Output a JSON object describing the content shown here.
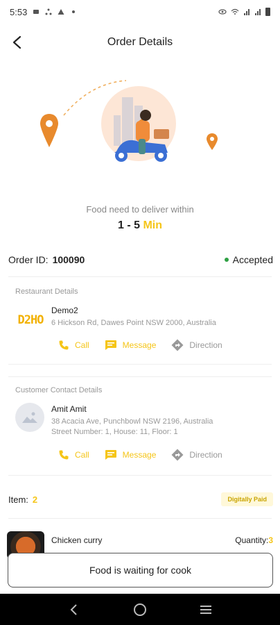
{
  "status_bar": {
    "time": "5:53"
  },
  "header": {
    "title": "Order Details"
  },
  "delivery": {
    "text": "Food need to deliver within",
    "range": "1 - 5",
    "unit": "Min"
  },
  "order": {
    "id_label": "Order ID:",
    "id_value": "100090",
    "status": "Accepted",
    "status_color": "#2ea043"
  },
  "restaurant": {
    "section_title": "Restaurant Details",
    "logo_text": "D2HO",
    "name": "Demo2",
    "address": "6 Hickson Rd, Dawes Point NSW 2000, Australia",
    "actions": {
      "call": "Call",
      "message": "Message",
      "direction": "Direction"
    }
  },
  "customer": {
    "section_title": "Customer Contact Details",
    "name": "Amit Amit",
    "address": "38 Acacia Ave, Punchbowl NSW 2196, Australia",
    "details": "Street Number: 1, House: 11, Floor: 1",
    "actions": {
      "call": "Call",
      "message": "Message",
      "direction": "Direction"
    }
  },
  "items": {
    "label": "Item:",
    "count": "2",
    "payment_badge": "Digitally Paid"
  },
  "food": {
    "name": "Chicken curry",
    "qty_label": "Quantity:",
    "qty": "3"
  },
  "wait_message": "Food is waiting for cook",
  "colors": {
    "accent": "#f5c518",
    "pin": "#e88a2d",
    "scooter": "#3b6fd4"
  },
  "icons": [
    "back-arrow-icon",
    "phone-icon",
    "message-icon",
    "direction-icon",
    "image-placeholder-icon",
    "location-pin-icon"
  ]
}
